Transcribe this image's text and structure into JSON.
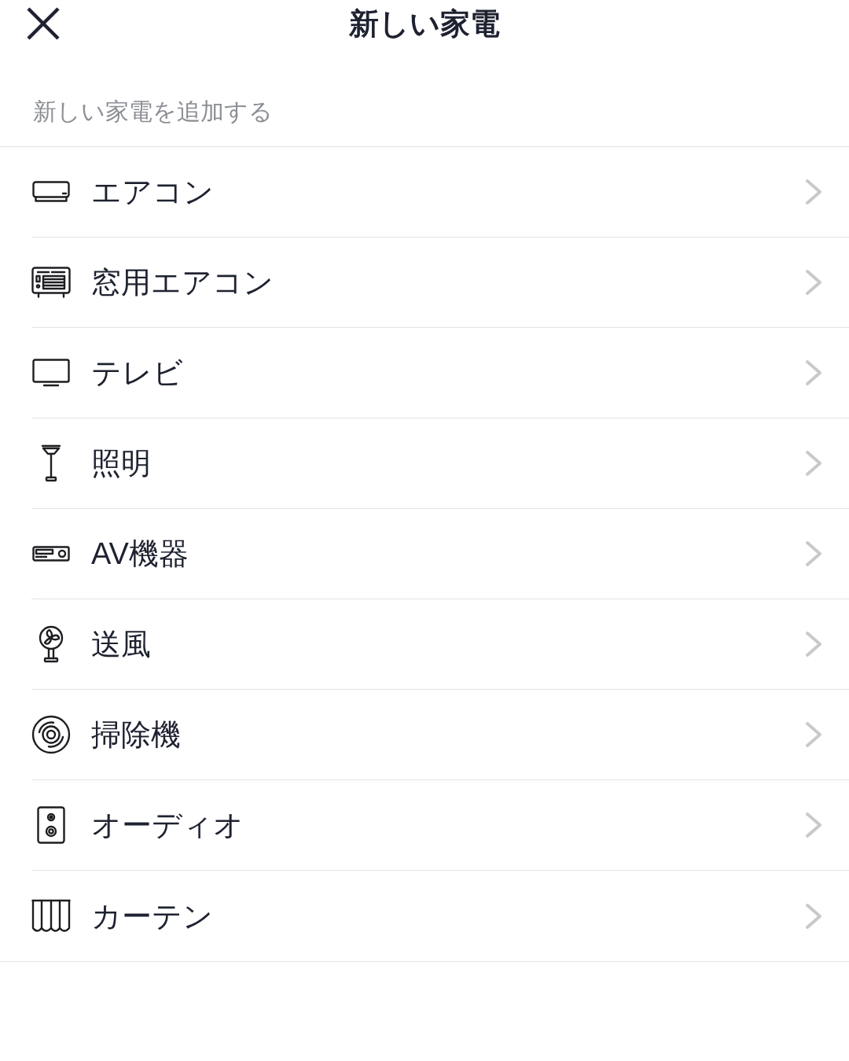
{
  "header": {
    "title": "新しい家電"
  },
  "section_label": "新しい家電を追加する",
  "items": [
    {
      "label": "エアコン"
    },
    {
      "label": "窓用エアコン"
    },
    {
      "label": "テレビ"
    },
    {
      "label": "照明"
    },
    {
      "label": "AV機器"
    },
    {
      "label": "送風"
    },
    {
      "label": "掃除機"
    },
    {
      "label": "オーディオ"
    },
    {
      "label": "カーテン"
    }
  ]
}
